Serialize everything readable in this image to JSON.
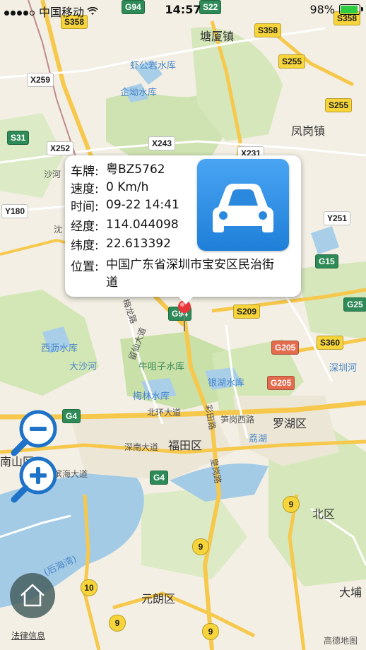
{
  "status_bar": {
    "carrier": "中国移动",
    "time": "14:57",
    "battery_text": "98%",
    "battery_level": 0.98,
    "signal_bars": 4,
    "wifi_icon": "wifi-icon"
  },
  "popup": {
    "rows": [
      {
        "key": "车牌:",
        "value": "粤BZ5762"
      },
      {
        "key": "速度:",
        "value": "0 Km/h"
      },
      {
        "key": "时间:",
        "value": "09-22 14:41"
      },
      {
        "key": "经度:",
        "value": "114.044098"
      },
      {
        "key": "纬度:",
        "value": "22.613392"
      },
      {
        "key": "位置:",
        "value": "中国广东省深圳市宝安区民治街道"
      }
    ],
    "icon": "car-icon"
  },
  "map": {
    "places": [
      {
        "name": "塘厦镇",
        "class": "place-dark"
      },
      {
        "name": "凤岗镇",
        "class": "place-dark"
      },
      {
        "name": "罗湖区",
        "class": "place-dark"
      },
      {
        "name": "福田区",
        "class": "place-dark"
      },
      {
        "name": "南山区",
        "class": "place-dark"
      },
      {
        "name": "北区",
        "class": "place-dark"
      },
      {
        "name": "元朗区",
        "class": "place-dark"
      },
      {
        "name": "大埔",
        "class": "place-dark"
      },
      {
        "name": "虾公岩水库",
        "class": "place-blue"
      },
      {
        "name": "企坳水库",
        "class": "place-blue"
      },
      {
        "name": "西沥水库",
        "class": "place-blue"
      },
      {
        "name": "大沙河",
        "class": "place-blue"
      },
      {
        "name": "梅林水库",
        "class": "place-blue"
      },
      {
        "name": "银湖水库",
        "class": "place-blue"
      },
      {
        "name": "深圳河",
        "class": "place-blue"
      },
      {
        "name": "荔湖",
        "class": "place-blue"
      },
      {
        "name": "(后海湾)",
        "class": "place-blue"
      },
      {
        "name": "牛咀子水库",
        "class": "place-green"
      },
      {
        "name": "北环大道",
        "class": "road-name"
      },
      {
        "name": "深南大道",
        "class": "road-name"
      },
      {
        "name": "滨海大道",
        "class": "road-name"
      },
      {
        "name": "笋岗西路",
        "class": "road-name"
      },
      {
        "name": "留仙大道",
        "class": "road-name"
      },
      {
        "name": "梅龙路",
        "class": "road-name"
      },
      {
        "name": "皇岗路",
        "class": "road-name"
      },
      {
        "name": "彩田路",
        "class": "road-name"
      },
      {
        "name": "沙河",
        "class": "road-name"
      },
      {
        "name": "沈",
        "class": "road-name"
      }
    ],
    "shields": [
      {
        "text": "S358",
        "style": "yellow"
      },
      {
        "text": "S358",
        "style": "yellow"
      },
      {
        "text": "S358",
        "style": "yellow"
      },
      {
        "text": "S255",
        "style": "yellow"
      },
      {
        "text": "S255",
        "style": "yellow"
      },
      {
        "text": "S209",
        "style": "yellow"
      },
      {
        "text": "S360",
        "style": "yellow"
      },
      {
        "text": "S22",
        "style": "green"
      },
      {
        "text": "G94",
        "style": "green"
      },
      {
        "text": "G94",
        "style": "green"
      },
      {
        "text": "G15",
        "style": "green"
      },
      {
        "text": "G25",
        "style": "green"
      },
      {
        "text": "G4",
        "style": "green"
      },
      {
        "text": "G4",
        "style": "green"
      },
      {
        "text": "S31",
        "style": "green"
      },
      {
        "text": "G205",
        "style": "red"
      },
      {
        "text": "G205",
        "style": "red"
      },
      {
        "text": "X259",
        "style": "white"
      },
      {
        "text": "X252",
        "style": "white"
      },
      {
        "text": "X243",
        "style": "white"
      },
      {
        "text": "X231",
        "style": "white"
      },
      {
        "text": "Y180",
        "style": "white"
      },
      {
        "text": "Y251",
        "style": "white"
      },
      {
        "text": "9",
        "style": "circle"
      },
      {
        "text": "9",
        "style": "circle"
      },
      {
        "text": "9",
        "style": "circle"
      },
      {
        "text": "9",
        "style": "circle"
      },
      {
        "text": "10",
        "style": "circle"
      }
    ]
  },
  "controls": {
    "zoom_out_icon": "zoom-out-icon",
    "zoom_in_icon": "zoom-in-icon",
    "home_icon": "home-icon"
  },
  "footer": {
    "legal": "法律信息",
    "logo": "高德地图"
  }
}
